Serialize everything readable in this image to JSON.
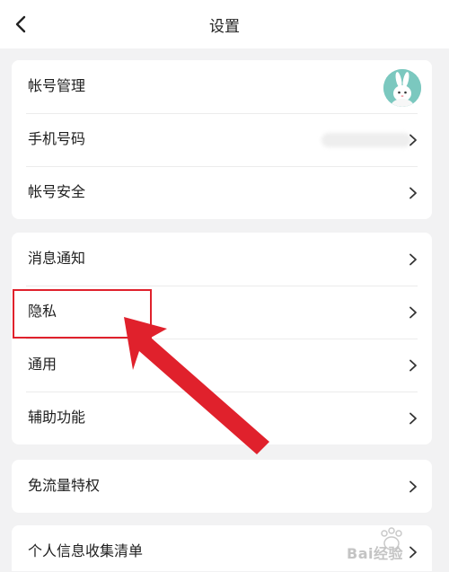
{
  "header": {
    "title": "设置"
  },
  "account_group": [
    {
      "label": "帐号管理"
    },
    {
      "label": "手机号码"
    },
    {
      "label": "帐号安全"
    }
  ],
  "general_group": [
    {
      "label": "消息通知"
    },
    {
      "label": "隐私"
    },
    {
      "label": "通用"
    },
    {
      "label": "辅助功能"
    }
  ],
  "traffic_group": [
    {
      "label": "免流量特权"
    }
  ],
  "info_group": [
    {
      "label": "个人信息收集清单"
    }
  ],
  "watermark": {
    "text": "Bai经验"
  },
  "colors": {
    "background": "#f2f2f3",
    "card": "#ffffff",
    "highlight": "#e0212c",
    "arrow": "#e0212c",
    "avatar_bg": "#7bc8bf"
  },
  "icons": {
    "back": "chevron-left-icon",
    "row_arrow": "chevron-right-icon"
  }
}
